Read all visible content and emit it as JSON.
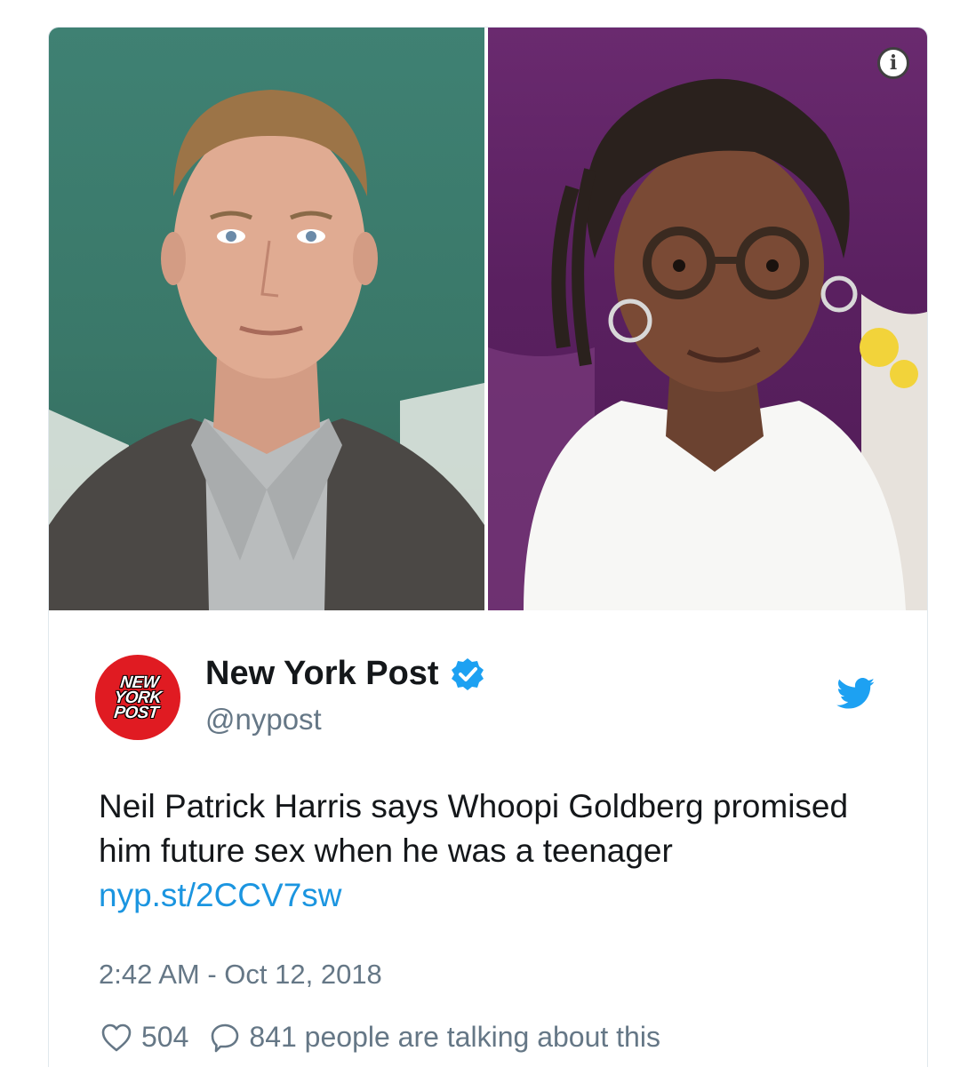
{
  "author": {
    "name": "New York Post",
    "handle": "@nypost",
    "avatar_text": [
      "NEW",
      "YORK",
      "POST"
    ]
  },
  "tweet": {
    "text": "Neil Patrick Harris says Whoopi Goldberg promised him future sex when he was a teenager",
    "link": "nyp.st/2CCV7sw",
    "timestamp": "2:42 AM - Oct 12, 2018"
  },
  "engagement": {
    "likes": "504",
    "talking": "841 people are talking about this"
  },
  "icons": {
    "info": "info-icon",
    "verified": "verified-badge-icon",
    "twitter": "twitter-bird-icon",
    "like": "heart-icon",
    "reply": "speech-bubble-icon"
  },
  "colors": {
    "link": "#1b95e0",
    "secondary_text": "#657786",
    "primary_text": "#14171a",
    "avatar_red": "#e01b22",
    "verified_blue": "#1da1f2"
  }
}
